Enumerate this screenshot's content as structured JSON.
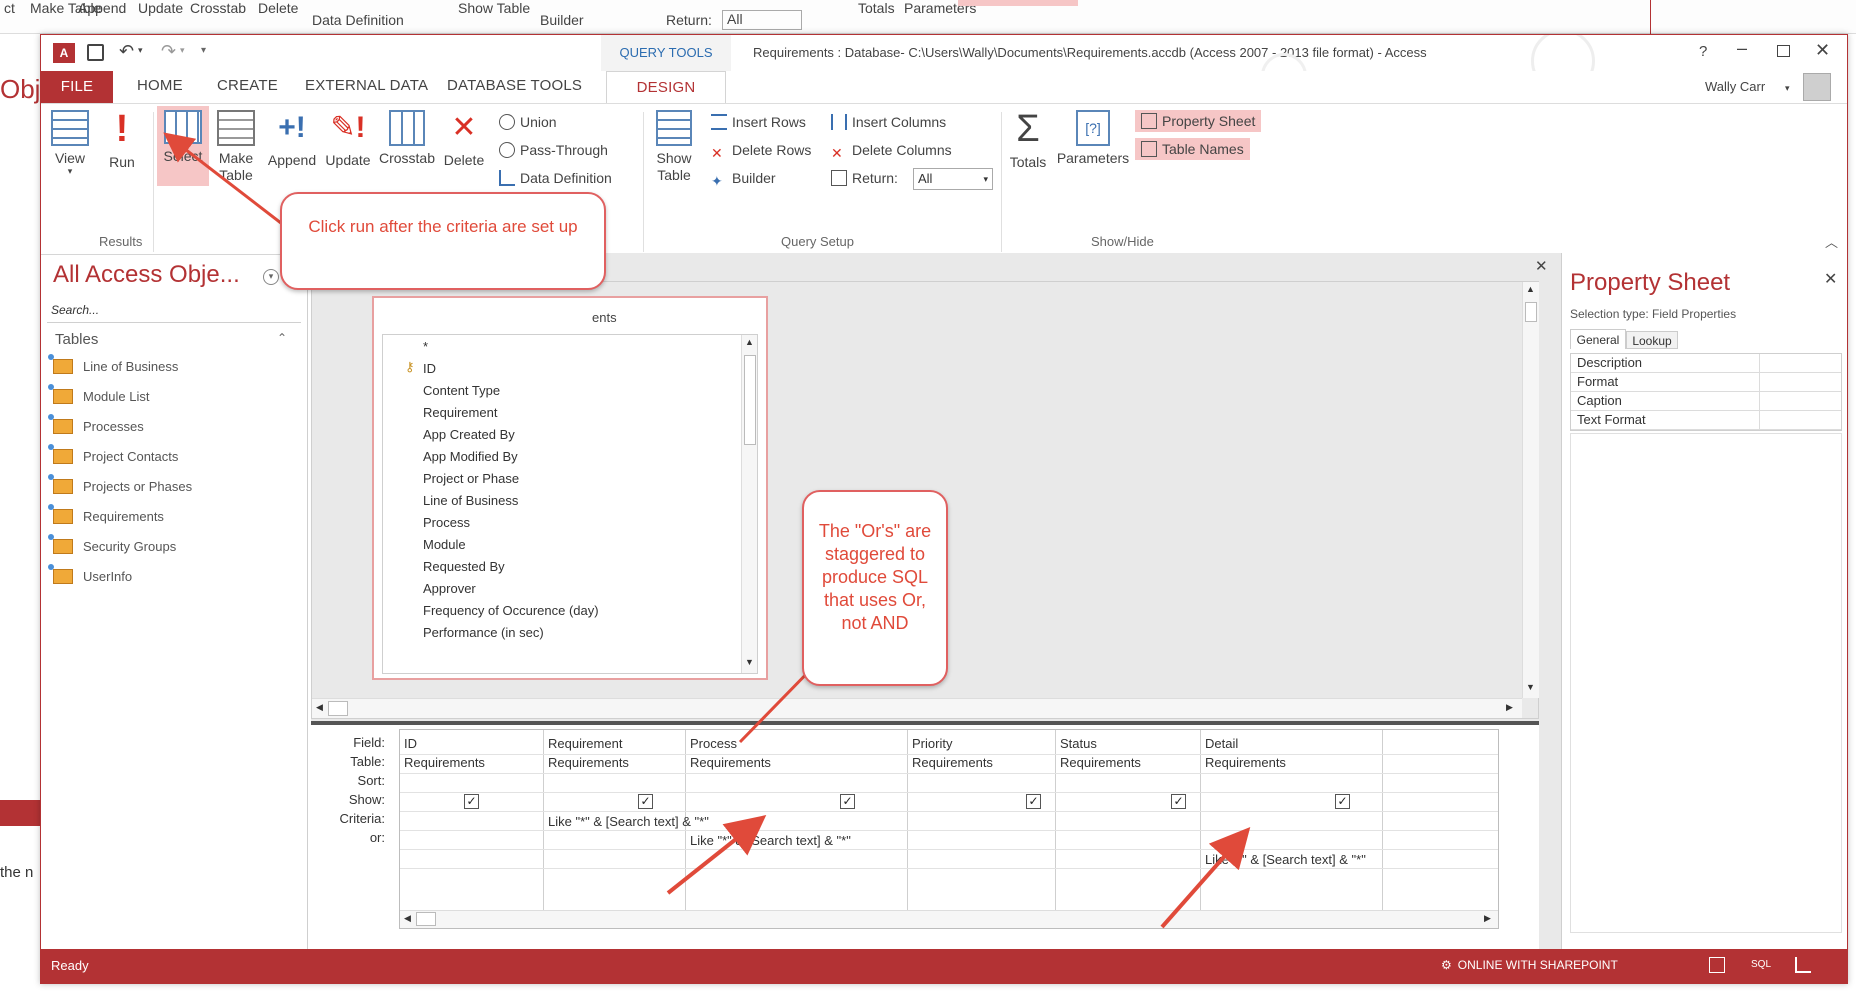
{
  "background": {
    "top_items": [
      "Make Table",
      "Append",
      "Update",
      "Crosstab",
      "Delete",
      "Data Definition",
      "Show Table",
      "Builder",
      "Return:",
      "All",
      "Totals",
      "Parameters"
    ],
    "left_texts": [
      "Obje",
      "the n"
    ]
  },
  "titlebar": {
    "context_tab": "QUERY TOOLS",
    "title": "Requirements : Database- C:\\Users\\Wally\\Documents\\Requirements.accdb (Access 2007 - 2013 file format) - Access",
    "help": "?",
    "user": "Wally Carr"
  },
  "tabs": [
    "FILE",
    "HOME",
    "CREATE",
    "EXTERNAL DATA",
    "DATABASE TOOLS",
    "DESIGN"
  ],
  "ribbon": {
    "results": {
      "view": "View",
      "run": "Run",
      "label": "Results"
    },
    "query_type": {
      "select": "Select",
      "make_table": "Make Table",
      "append": "Append",
      "update": "Update",
      "crosstab": "Crosstab",
      "delete": "Delete",
      "union": "Union",
      "pass_through": "Pass-Through",
      "data_definition": "Data Definition"
    },
    "query_setup": {
      "show_table": "Show Table",
      "insert_rows": "Insert Rows",
      "delete_rows": "Delete Rows",
      "builder": "Builder",
      "insert_columns": "Insert Columns",
      "delete_columns": "Delete Columns",
      "return_label": "Return:",
      "return_value": "All",
      "label": "Query Setup"
    },
    "show_hide": {
      "totals": "Totals",
      "parameters": "Parameters",
      "property_sheet": "Property Sheet",
      "table_names": "Table Names",
      "label": "Show/Hide"
    }
  },
  "nav": {
    "title": "All Access Obje...",
    "search_placeholder": "Search...",
    "section": "Tables",
    "tables": [
      "Line of Business",
      "Module List",
      "Processes",
      "Project Contacts",
      "Projects or Phases",
      "Requirements",
      "Security Groups",
      "UserInfo"
    ]
  },
  "field_list": {
    "title_partial": "ents",
    "fields": [
      "*",
      "ID",
      "Content Type",
      "Requirement",
      "App Created By",
      "App Modified By",
      "Project or Phase",
      "Line of Business",
      "Process",
      "Module",
      "Requested By",
      "Approver",
      "Frequency of Occurence (day)",
      "Performance (in sec)"
    ]
  },
  "grid": {
    "row_labels": [
      "Field:",
      "Table:",
      "Sort:",
      "Show:",
      "Criteria:",
      "or:"
    ],
    "columns": [
      {
        "field": "ID",
        "table": "Requirements",
        "show": true,
        "criteria": "",
        "or": ""
      },
      {
        "field": "Requirement",
        "table": "Requirements",
        "show": true,
        "criteria": "Like \"*\" & [Search text] & \"*\"",
        "or": ""
      },
      {
        "field": "Process",
        "table": "Requirements",
        "show": true,
        "criteria": "",
        "or": "Like \"*\" & [Search text] & \"*\""
      },
      {
        "field": "Priority",
        "table": "Requirements",
        "show": true,
        "criteria": "",
        "or": ""
      },
      {
        "field": "Status",
        "table": "Requirements",
        "show": true,
        "criteria": "",
        "or": ""
      },
      {
        "field": "Detail",
        "table": "Requirements",
        "show": true,
        "criteria": "",
        "or": "",
        "or2": "Like \"*\" & [Search text] & \"*\""
      }
    ]
  },
  "property_sheet": {
    "title": "Property Sheet",
    "selection_type": "Selection type:  Field Properties",
    "tabs": [
      "General",
      "Lookup"
    ],
    "rows": [
      "Description",
      "Format",
      "Caption",
      "Text Format"
    ]
  },
  "callouts": {
    "run": "Click run after the criteria are set up",
    "ors": "The \"Or's\" are staggered to produce SQL that uses Or, not AND"
  },
  "status": {
    "left": "Ready",
    "right": "ONLINE WITH SHAREPOINT",
    "sql": "SQL"
  },
  "colors": {
    "access_red": "#b33234",
    "callout_red": "#e04a3a",
    "highlight_pink": "#f6c6c6"
  }
}
